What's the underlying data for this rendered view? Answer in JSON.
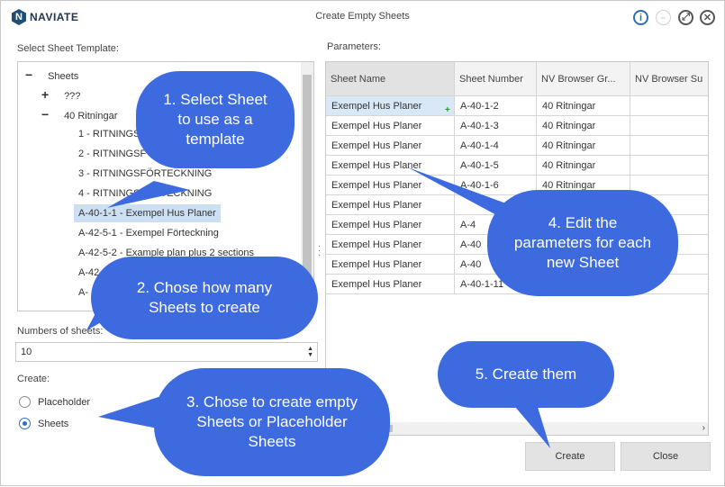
{
  "window": {
    "title": "Create Empty Sheets",
    "logo_text": "NAVIATE",
    "logo_letter": "N"
  },
  "left": {
    "template_label": "Select Sheet Template:",
    "tree": [
      {
        "toggle": "−",
        "label": "Sheets"
      },
      {
        "toggle": "+",
        "label": "???"
      },
      {
        "toggle": "−",
        "label": "40 Ritningar"
      },
      {
        "toggle": "",
        "label": "1 - RITNINGS"
      },
      {
        "toggle": "",
        "label": "2 - RITNINGSF"
      },
      {
        "toggle": "",
        "label": "3 - RITNINGSFÖRTECKNING"
      },
      {
        "toggle": "",
        "label": "4 - RITNINGSFÖRTECKNING"
      },
      {
        "toggle": "",
        "label": "A-40-1-1 - Exempel Hus Planer"
      },
      {
        "toggle": "",
        "label": "A-42-5-1 - Exempel Förteckning"
      },
      {
        "toggle": "",
        "label": "A-42-5-2 - Example plan plus 2 sections"
      },
      {
        "toggle": "",
        "label": "A-42"
      },
      {
        "toggle": "",
        "label": "A-"
      }
    ],
    "numbers_label": "Numbers of sheets:",
    "numbers_value": "10",
    "create_label": "Create:",
    "radio_placeholder": "Placeholder",
    "radio_sheets": "Sheets"
  },
  "grid": {
    "label": "Parameters:",
    "columns": [
      "Sheet Name",
      "Sheet Number",
      "NV  Browser Gr...",
      "NV  Browser Su"
    ],
    "rows": [
      [
        "Exempel Hus Planer",
        "A-40-1-2",
        "40 Ritningar",
        ""
      ],
      [
        "Exempel Hus Planer",
        "A-40-1-3",
        "40 Ritningar",
        ""
      ],
      [
        "Exempel Hus Planer",
        "A-40-1-4",
        "40 Ritningar",
        ""
      ],
      [
        "Exempel Hus Planer",
        "A-40-1-5",
        "40 Ritningar",
        ""
      ],
      [
        "Exempel Hus Planer",
        "A-40-1-6",
        "40 Ritningar",
        ""
      ],
      [
        "Exempel Hus Planer",
        "",
        "",
        ""
      ],
      [
        "Exempel Hus Planer",
        "A-4",
        "",
        ""
      ],
      [
        "Exempel Hus Planer",
        "A-40",
        "",
        ""
      ],
      [
        "Exempel Hus Planer",
        "A-40",
        "",
        ""
      ],
      [
        "Exempel Hus Planer",
        "A-40-1-11",
        "",
        ""
      ]
    ]
  },
  "buttons": {
    "create": "Create",
    "close": "Close"
  },
  "callouts": {
    "c1": "1. Select Sheet to use as a template",
    "c2": "2. Chose how many Sheets to create",
    "c3": "3. Chose to create empty Sheets or Placeholder Sheets",
    "c4": "4. Edit the parameters for each new Sheet",
    "c5": "5. Create them"
  },
  "colors": {
    "callout": "#3d6bdf",
    "selection": "#cde0f3",
    "accent": "#2f6db5"
  }
}
